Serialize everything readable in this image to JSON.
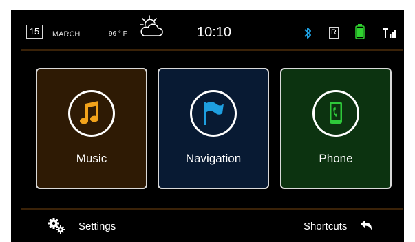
{
  "status_bar": {
    "date_day": "15",
    "month": "MARCH",
    "temperature": "96 ° F",
    "weather_icon": "partly-cloudy-icon",
    "time": "10:10",
    "bluetooth_icon": "bluetooth-icon",
    "radio_indicator": "R",
    "battery_icon": "battery-icon",
    "signal_icon": "signal-icon"
  },
  "tiles": [
    {
      "label": "Music",
      "icon": "music-note-icon",
      "bg": "#2e1a04",
      "accent": "#f2a31b"
    },
    {
      "label": "Navigation",
      "icon": "flag-icon",
      "bg": "#081a33",
      "accent": "#1e9fe0"
    },
    {
      "label": "Phone",
      "icon": "phone-icon",
      "bg": "#0c3310",
      "accent": "#2ec93a"
    }
  ],
  "bottom_bar": {
    "settings_label": "Settings",
    "settings_icon": "gears-icon",
    "shortcuts_label": "Shortcuts",
    "shortcuts_icon": "return-arrow-icon"
  },
  "colors": {
    "background": "#000000",
    "divider": "#3a2208",
    "battery": "#2fd12f"
  }
}
